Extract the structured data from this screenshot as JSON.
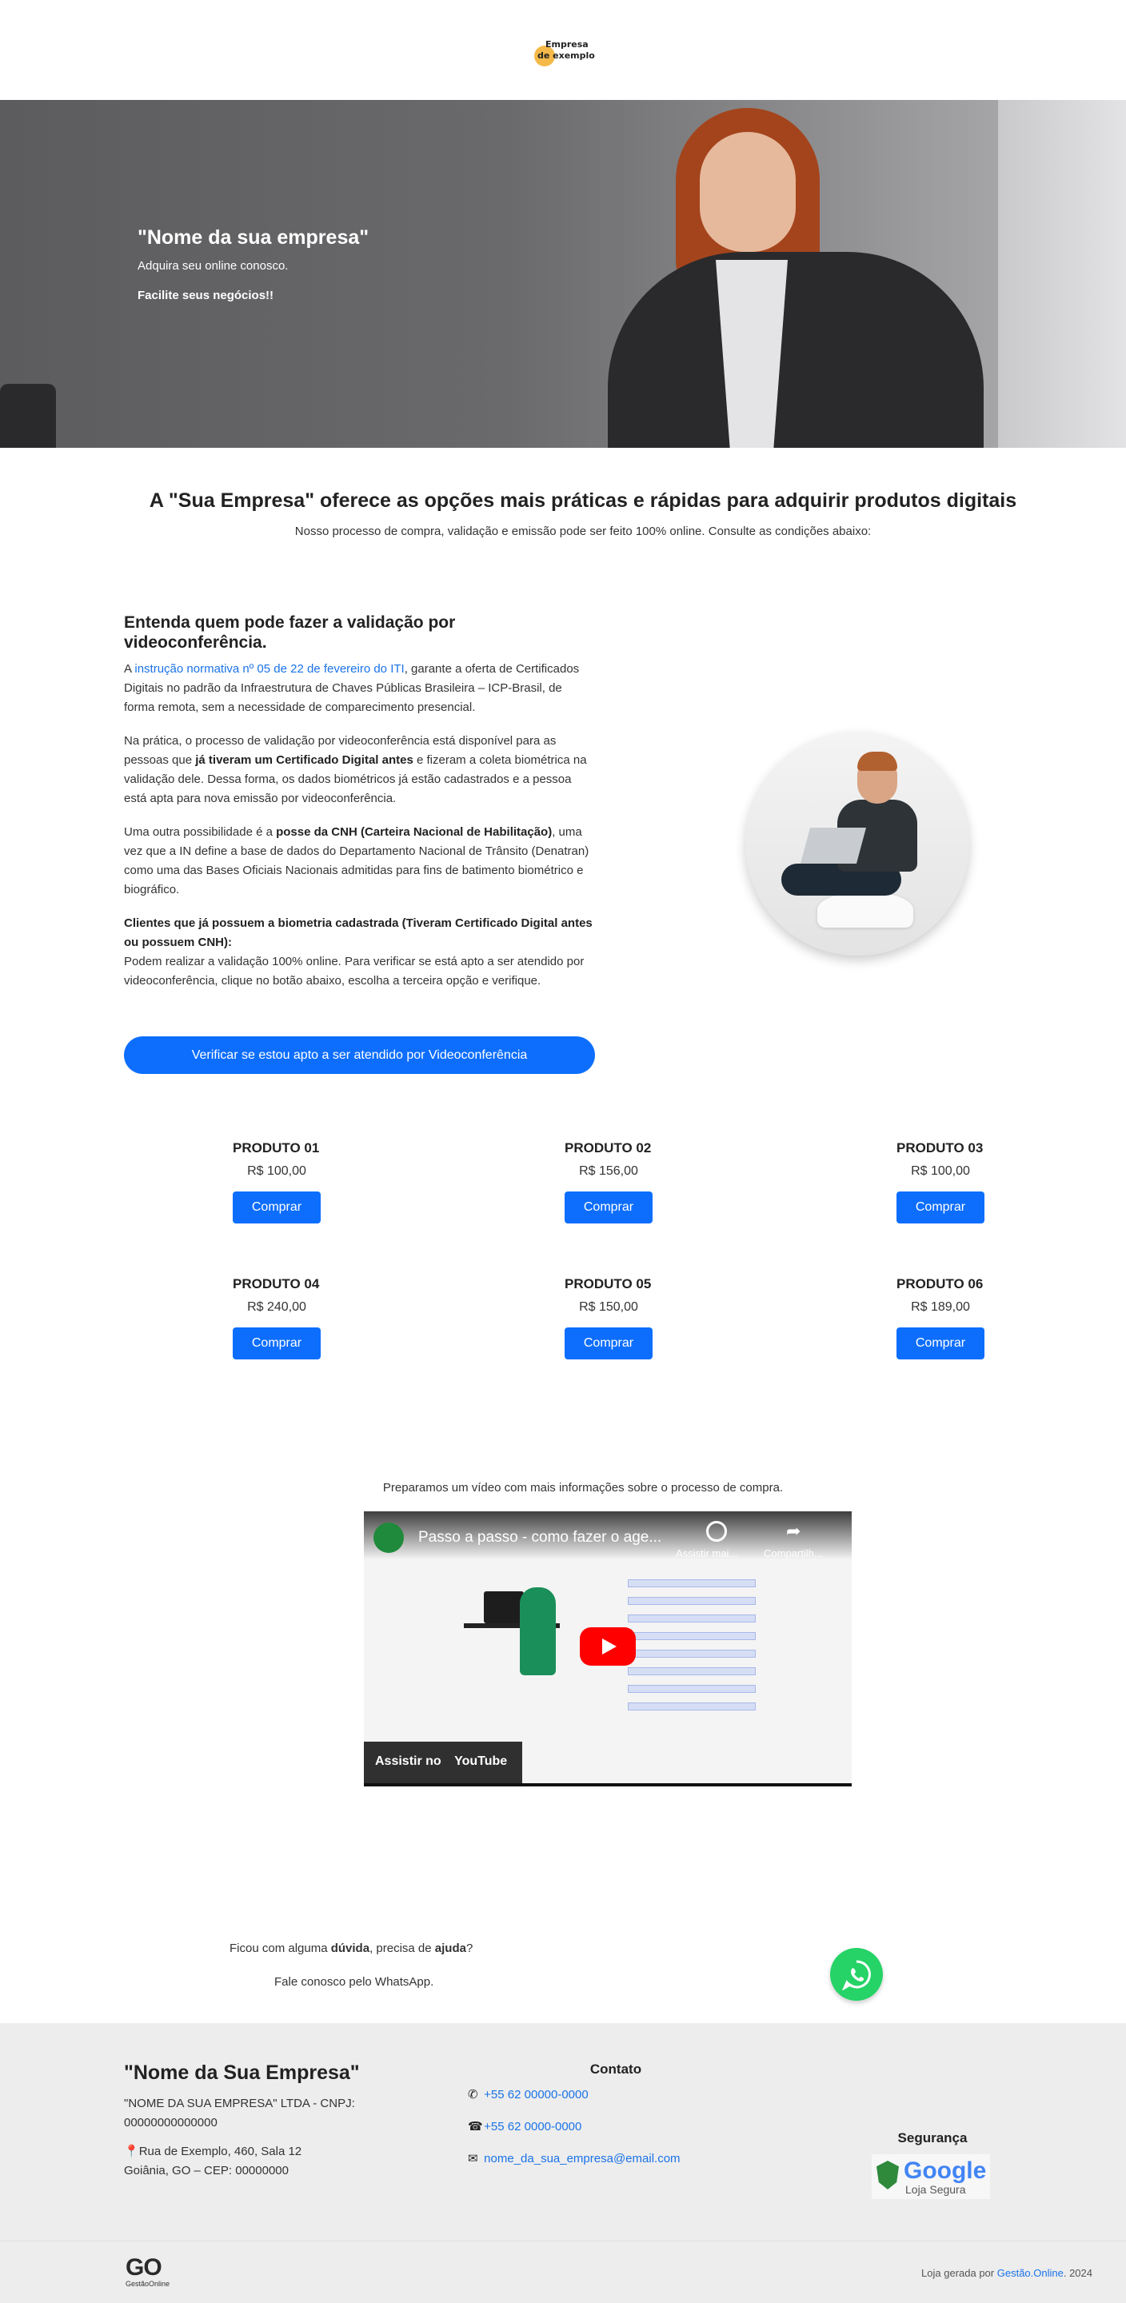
{
  "header": {
    "logo_line1": "Empresa",
    "logo_line2": "de exemplo"
  },
  "hero": {
    "title": "\"Nome da sua empresa\"",
    "subtitle": "Adquira seu online conosco.",
    "tagline": "Facilite seus negócios!!"
  },
  "offer": {
    "title": "A \"Sua Empresa\" oferece as opções mais práticas e rápidas para adquirir produtos digitais",
    "subtitle": "Nosso processo de compra, validação e emissão pode ser feito 100% online. Consulte as condições abaixo:"
  },
  "info": {
    "heading": "Entenda quem pode fazer a validação por videoconferência.",
    "p1_prefix": "A ",
    "p1_link": "instrução normativa nº 05 de 22 de fevereiro do ITI",
    "p1_suffix": ", garante a oferta de Certificados Digitais no padrão da Infraestrutura de Chaves Públicas Brasileira – ICP-Brasil, de forma remota, sem a necessidade de comparecimento presencial.",
    "p2_prefix": "Na prática, o processo de validação por videoconferência está disponível para as pessoas que ",
    "p2_bold": "já tiveram um Certificado Digital antes",
    "p2_suffix": " e fizeram a coleta biométrica na validação dele. Dessa forma, os dados biométricos já estão cadastrados e a pessoa está apta para nova emissão por videoconferência.",
    "p3_prefix": "Uma outra possibilidade é a ",
    "p3_bold": "posse da CNH (Carteira Nacional de Habilitação)",
    "p3_suffix": ", uma vez que a IN define a base de dados do Departamento Nacional de Trânsito (Denatran) como uma das Bases Oficiais Nacionais admitidas para fins de batimento biométrico e biográfico.",
    "p4_bold": "Clientes que já possuem a biometria cadastrada (Tiveram Certificado Digital antes ou possuem CNH):",
    "p4_text": "Podem realizar a validação 100% online. Para verificar se está apto a ser atendido por videoconferência, clique no botão abaixo, escolha a terceira opção e verifique.",
    "cta": "Verificar se estou apto a ser atendido por Videoconferência"
  },
  "products": [
    {
      "name": "PRODUTO 01",
      "price": "R$ 100,00",
      "button": "Comprar"
    },
    {
      "name": "PRODUTO 02",
      "price": "R$ 156,00",
      "button": "Comprar"
    },
    {
      "name": "PRODUTO 03",
      "price": "R$ 100,00",
      "button": "Comprar"
    },
    {
      "name": "PRODUTO 04",
      "price": "R$ 240,00",
      "button": "Comprar"
    },
    {
      "name": "PRODUTO 05",
      "price": "R$ 150,00",
      "button": "Comprar"
    },
    {
      "name": "PRODUTO 06",
      "price": "R$ 189,00",
      "button": "Comprar"
    }
  ],
  "video": {
    "caption": "Preparamos um vídeo com mais informações sobre o processo de compra.",
    "title": "Passo a passo - como fazer o age...",
    "action_later": "Assistir mai...",
    "action_share": "Compartilh...",
    "watch_on": "Assistir no",
    "youtube": "YouTube"
  },
  "help": {
    "line1_prefix": "Ficou com alguma ",
    "line1_bold1": "dúvida",
    "line1_mid": ", precisa de ",
    "line1_bold2": "ajuda",
    "line1_suffix": "?",
    "line2": "Fale conosco pelo WhatsApp."
  },
  "footer": {
    "company_name": "\"Nome da Sua Empresa\"",
    "legal": "\"NOME DA SUA EMPRESA\" LTDA - CNPJ: 00000000000000",
    "address_line1": "Rua de Exemplo, 460, Sala 12",
    "address_line2": "Goiânia, GO – CEP: 00000000",
    "contact_title": "Contato",
    "whatsapp": "+55 62 00000-0000",
    "phone": "+55 62 0000-0000",
    "email": "nome_da_sua_empresa@email.com",
    "security_title": "Segurança",
    "badge_brand": "Google",
    "badge_label": "Loja Segura",
    "brand_big": "GO",
    "brand_small": "GestãoOnline",
    "generated_prefix": "Loja gerada por ",
    "generated_link": "Gestão.Online",
    "generated_year": ". 2024"
  },
  "colors": {
    "primary": "#0d6efd",
    "link": "#1a73e8",
    "footer_bg": "#ededed",
    "whatsapp": "#25d366"
  }
}
